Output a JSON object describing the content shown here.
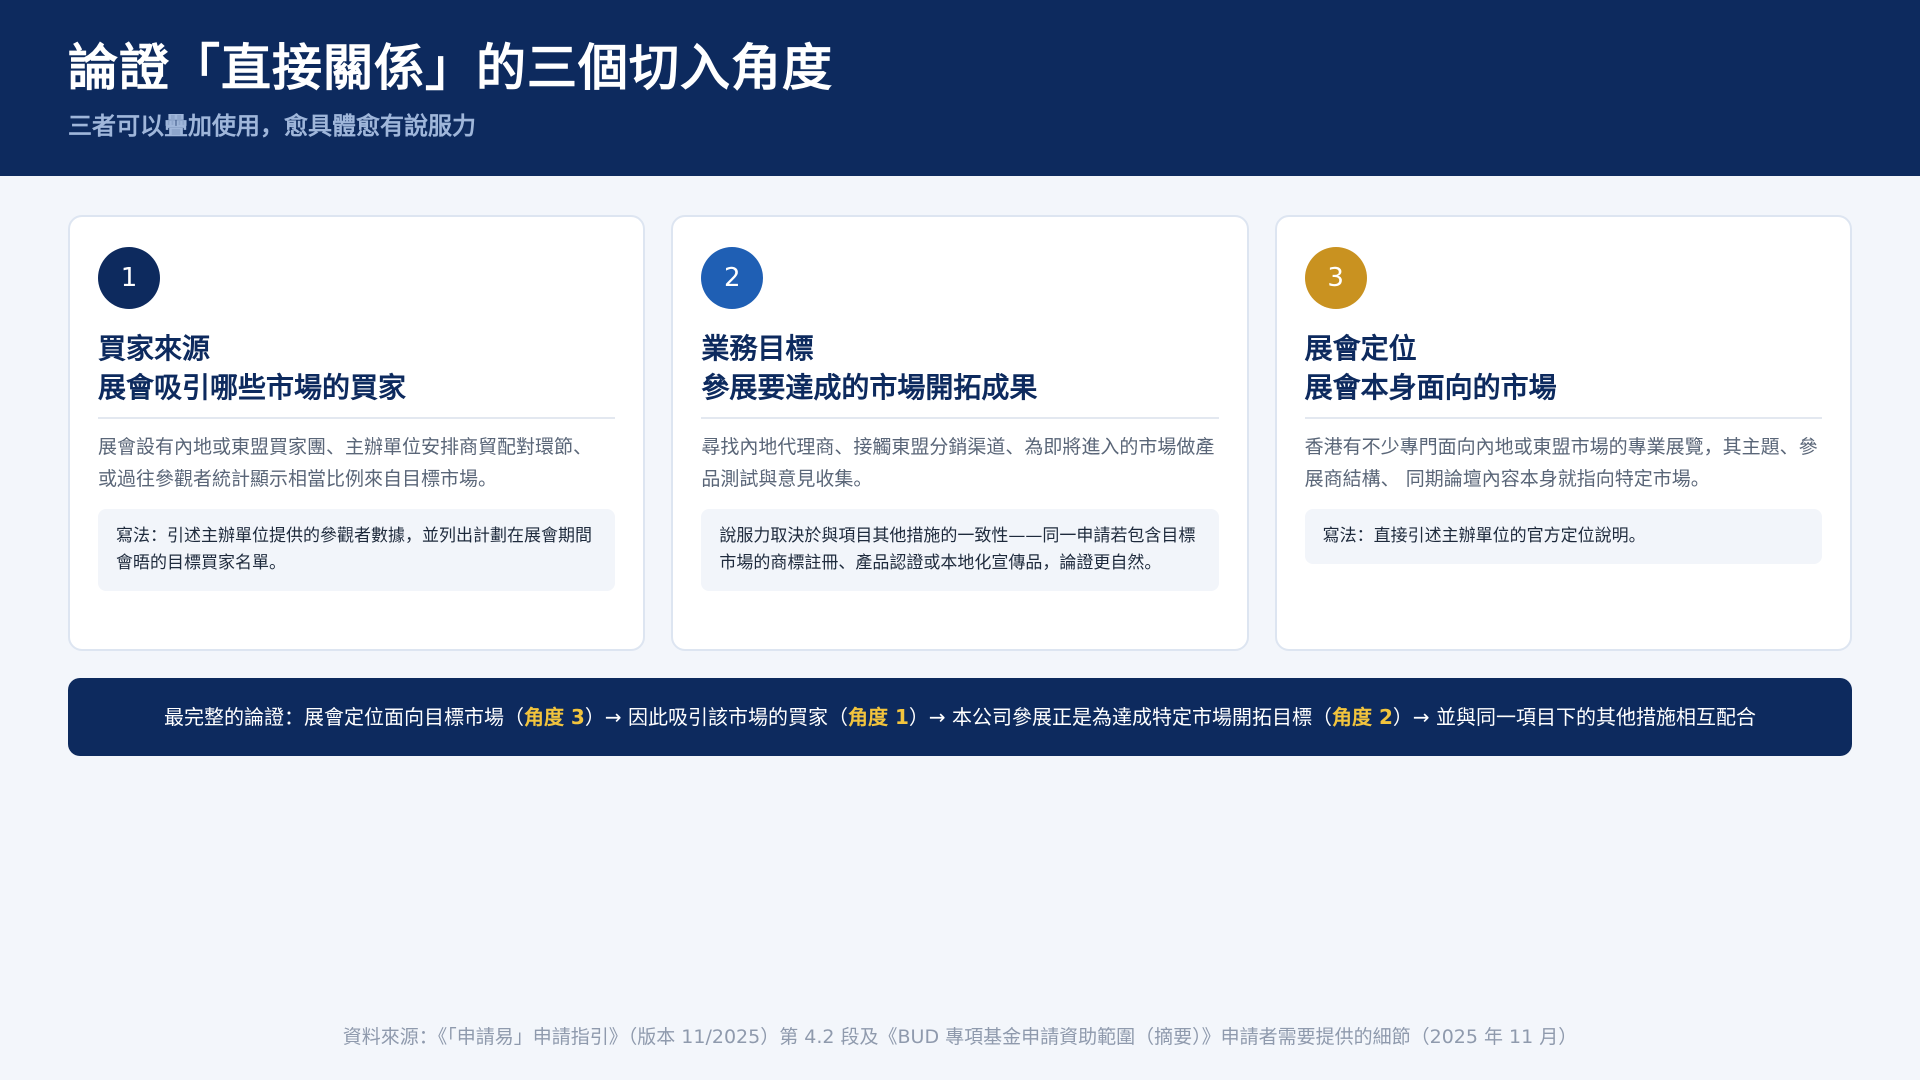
{
  "header": {
    "title": "論證「直接關係」的三個切入角度",
    "subtitle": "三者可以疊加使用，愈具體愈有說服力"
  },
  "cards": [
    {
      "number": "1",
      "title_line1": "買家來源",
      "title_line2": "展會吸引哪些市場的買家",
      "description": "展會設有內地或東盟買家團、主辦單位安排商貿配對環節、 或過往參觀者統計顯示相當比例來自目標市場。",
      "note": "寫法：引述主辦單位提供的參觀者數據，並列出計劃在展會期間會晤的目標買家名單。",
      "badge_color": "#0d2a5e"
    },
    {
      "number": "2",
      "title_line1": "業務目標",
      "title_line2": "參展要達成的市場開拓成果",
      "description": "尋找內地代理商、接觸東盟分銷渠道、為即將進入的市場做產品測試與意見收集。",
      "note": "說服力取決於與項目其他措施的一致性——同一申請若包含目標市場的商標註冊、產品認證或本地化宣傳品，論證更自然。",
      "badge_color": "#1f5fb4"
    },
    {
      "number": "3",
      "title_line1": "展會定位",
      "title_line2": "展會本身面向的市場",
      "description": "香港有不少專門面向內地或東盟市場的專業展覽，其主題、參展商結構、 同期論壇內容本身就指向特定市場。",
      "note": "寫法：直接引述主辦單位的官方定位說明。",
      "badge_color": "#c99220"
    }
  ],
  "summary": {
    "part1": "最完整的論證：展會定位面向目標市場（",
    "hl1": "角度 3",
    "part2": "）→ 因此吸引該市場的買家（",
    "hl2": "角度 1",
    "part3": "）→ 本公司參展正是為達成特定市場開拓目標（",
    "hl3": "角度 2",
    "part4": "）→ 並與同一項目下的其他措施相互配合",
    "highlight_color": "#f2c43d"
  },
  "footer": {
    "source": "資料來源：《「申請易」申請指引》（版本 11/2025）第 4.2 段及《BUD 專項基金申請資助範圍（摘要）》申請者需要提供的細節（2025 年 11 月）"
  }
}
